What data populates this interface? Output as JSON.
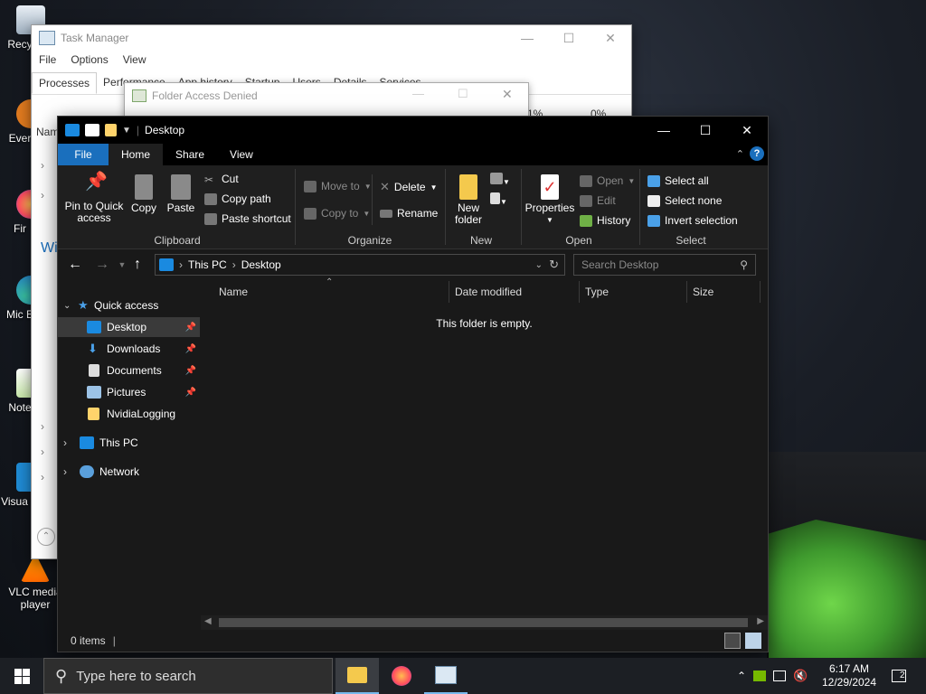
{
  "desktop": {
    "icons": [
      {
        "label": "Recy",
        "icon": "recycle-bin-icon"
      },
      {
        "label": "Ever",
        "icon": "everything-icon"
      },
      {
        "label": "Fir",
        "icon": "firefox-icon"
      },
      {
        "label": "Mic E",
        "icon": "edge-icon"
      },
      {
        "label": "Note",
        "icon": "notepadpp-icon"
      },
      {
        "label": "Visua C",
        "icon": "vscode-icon"
      },
      {
        "label": "VLC media player",
        "icon": "vlc-icon"
      }
    ]
  },
  "task_manager": {
    "title": "Task Manager",
    "menu": [
      "File",
      "Options",
      "View"
    ],
    "tabs": [
      "Processes",
      "Performance",
      "App history",
      "Startup",
      "Users",
      "Details",
      "Services"
    ],
    "col_name": "Nam",
    "cpu": "1%",
    "mem": "0%",
    "side_text": "Wi"
  },
  "folder_access_denied": {
    "title": "Folder Access Denied"
  },
  "explorer": {
    "title": "Desktop",
    "ribbon_tabs": [
      "File",
      "Home",
      "Share",
      "View"
    ],
    "help": "?",
    "clipboard": {
      "pin": "Pin to Quick access",
      "pin_l1": "Pin to Quick",
      "pin_l2": "access",
      "copy": "Copy",
      "paste": "Paste",
      "cut": "Cut",
      "copy_path": "Copy path",
      "paste_shortcut": "Paste shortcut",
      "label": "Clipboard"
    },
    "organize": {
      "move_to": "Move to",
      "copy_to": "Copy to",
      "delete": "Delete",
      "rename": "Rename",
      "label": "Organize"
    },
    "new": {
      "new_folder_l1": "New",
      "new_folder_l2": "folder",
      "label": "New"
    },
    "open": {
      "properties": "Properties",
      "open": "Open",
      "edit": "Edit",
      "history": "History",
      "label": "Open"
    },
    "select": {
      "select_all": "Select all",
      "select_none": "Select none",
      "invert": "Invert selection",
      "label": "Select"
    },
    "address": {
      "crumbs": [
        "This PC",
        "Desktop"
      ],
      "search_placeholder": "Search Desktop"
    },
    "nav": {
      "quick_access": "Quick access",
      "items": [
        "Desktop",
        "Downloads",
        "Documents",
        "Pictures",
        "NvidiaLogging"
      ],
      "this_pc": "This PC",
      "network": "Network"
    },
    "columns": [
      "Name",
      "Date modified",
      "Type",
      "Size"
    ],
    "empty_text": "This folder is empty.",
    "status": "0 items"
  },
  "taskbar": {
    "search_placeholder": "Type here to search",
    "time": "6:17 AM",
    "date": "12/29/2024",
    "notifications": "2"
  },
  "colors": {
    "accent": "#1a6fbd",
    "explorer_bg": "#191919",
    "taskbar_bg": "#1c1f24"
  }
}
